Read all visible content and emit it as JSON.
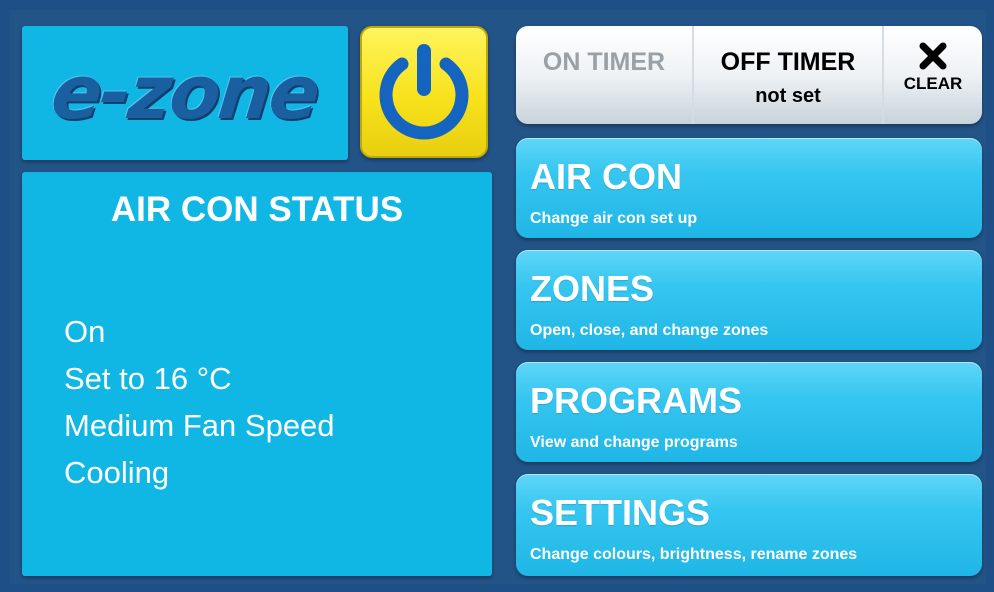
{
  "app": {
    "logo": "e-zone"
  },
  "power": {
    "icon": "power-icon"
  },
  "status": {
    "title": "AIR CON STATUS",
    "lines": [
      "On",
      "Set to 16 °C",
      "Medium Fan Speed",
      "Cooling"
    ]
  },
  "timer": {
    "on_label": "ON TIMER",
    "off_label": "OFF TIMER",
    "off_value": "not set",
    "clear_label": "CLEAR",
    "clear_icon": "close-icon"
  },
  "menu": [
    {
      "title": "AIR CON",
      "subtitle": "Change air con set up"
    },
    {
      "title": "ZONES",
      "subtitle": "Open, close, and change zones"
    },
    {
      "title": "PROGRAMS",
      "subtitle": "View and change programs"
    },
    {
      "title": "SETTINGS",
      "subtitle": "Change colours, brightness, rename zones"
    }
  ],
  "colors": {
    "background": "#235488",
    "panel": "#11b7e4",
    "power_button": "#f7e21c",
    "power_glyph": "#1565c0"
  }
}
